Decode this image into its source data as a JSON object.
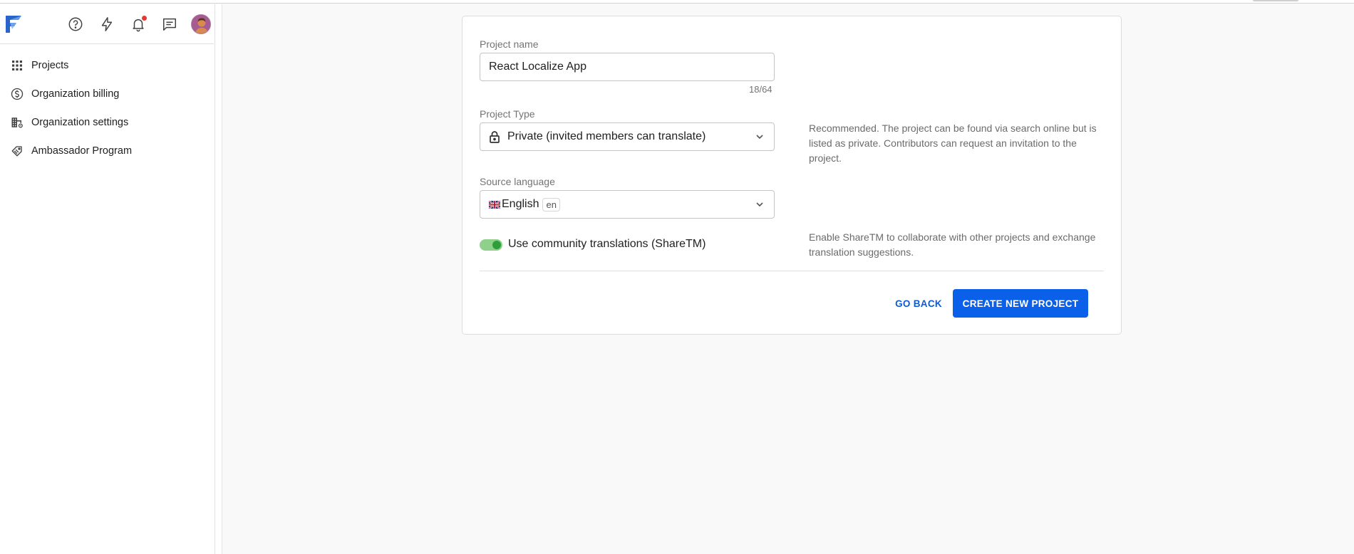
{
  "sidebar": {
    "header_icons": {
      "logo": "app-logo",
      "help": "help-circle-icon",
      "activity": "lightning-icon",
      "notifications": "bell-icon",
      "messages": "chat-icon",
      "has_unread_notifications": true
    },
    "items": [
      {
        "label": "Projects",
        "icon": "grid-icon"
      },
      {
        "label": "Organization billing",
        "icon": "dollar-circle-icon"
      },
      {
        "label": "Organization settings",
        "icon": "building-gear-icon"
      },
      {
        "label": "Ambassador Program",
        "icon": "tag-hand-icon"
      }
    ]
  },
  "form": {
    "project_name": {
      "label": "Project name",
      "value": "React Localize App",
      "counter": "18/64"
    },
    "project_type": {
      "label": "Project Type",
      "value": "Private (invited members can translate)",
      "icon": "lock-icon",
      "helper": "Recommended. The project can be found via search online but is listed as private. Contributors can request an invitation to the project."
    },
    "source_language": {
      "label": "Source language",
      "value": "English",
      "code": "en",
      "flag": "uk-flag-icon"
    },
    "community": {
      "label": "Use community translations (ShareTM)",
      "enabled": true,
      "helper": "Enable ShareTM to collaborate with other projects and exchange translation suggestions."
    },
    "actions": {
      "back_label": "GO BACK",
      "create_label": "CREATE NEW PROJECT"
    }
  },
  "colors": {
    "primary": "#0a60e8",
    "link": "#0d5bd8",
    "toggle_on": "#2e9e3a",
    "notification": "#e53935"
  }
}
